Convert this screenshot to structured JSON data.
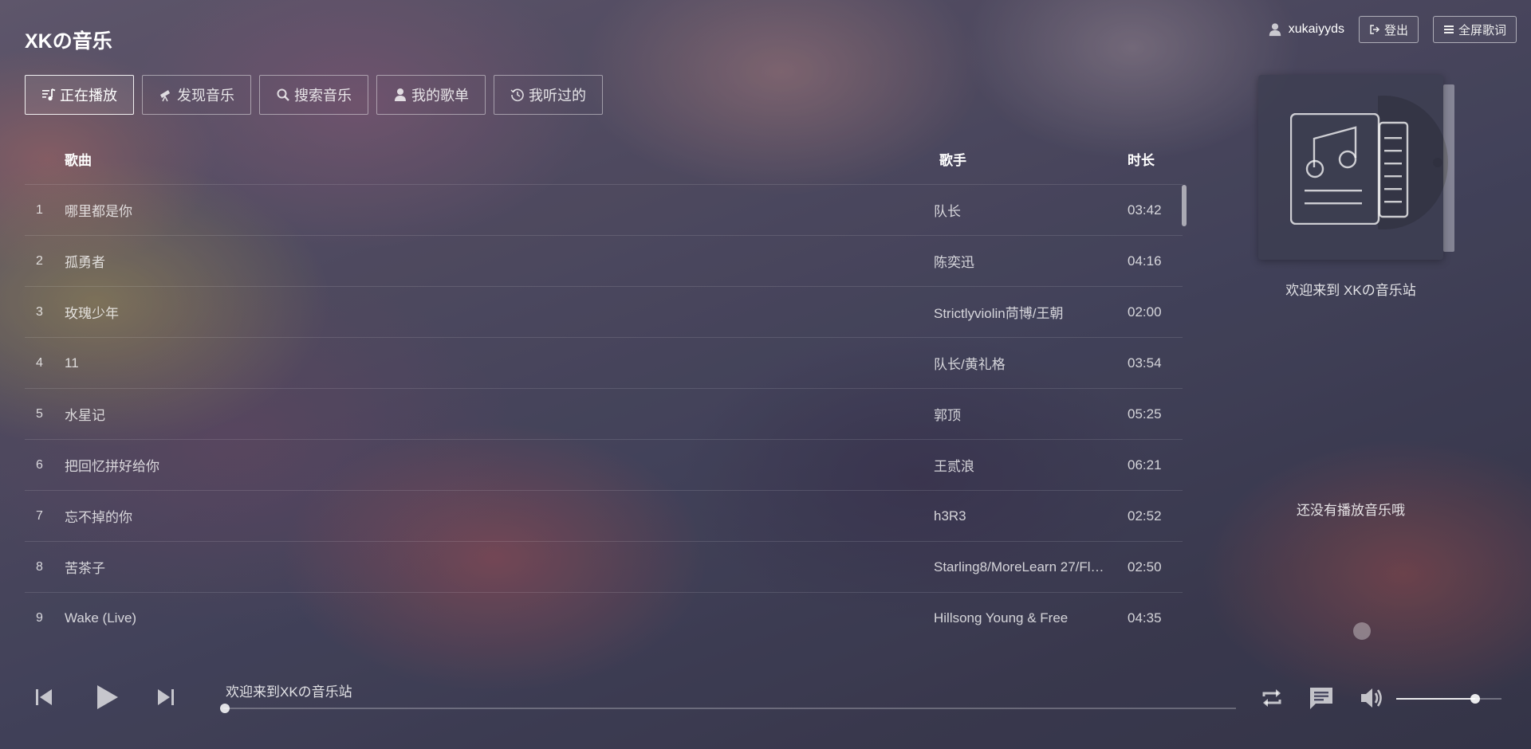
{
  "header": {
    "title": "XKの音乐",
    "username": "xukaiyyds",
    "logout_label": "登出",
    "fullscreen_lyrics_label": "全屏歌词"
  },
  "tabs": [
    {
      "label": "正在播放",
      "icon": "now-playing-icon",
      "active": true
    },
    {
      "label": "发现音乐",
      "icon": "telescope-icon",
      "active": false
    },
    {
      "label": "搜索音乐",
      "icon": "search-icon",
      "active": false
    },
    {
      "label": "我的歌单",
      "icon": "user-icon",
      "active": false
    },
    {
      "label": "我听过的",
      "icon": "history-icon",
      "active": false
    }
  ],
  "table": {
    "headers": {
      "song": "歌曲",
      "artist": "歌手",
      "duration": "时长"
    },
    "rows": [
      {
        "index": "1",
        "song": "哪里都是你",
        "artist": "队长",
        "duration": "03:42"
      },
      {
        "index": "2",
        "song": "孤勇者",
        "artist": "陈奕迅",
        "duration": "04:16"
      },
      {
        "index": "3",
        "song": "玫瑰少年",
        "artist": "Strictlyviolin苘博/王朝",
        "duration": "02:00"
      },
      {
        "index": "4",
        "song": "11",
        "artist": "队长/黄礼格",
        "duration": "03:54"
      },
      {
        "index": "5",
        "song": "水星记",
        "artist": "郭顶",
        "duration": "05:25"
      },
      {
        "index": "6",
        "song": "把回忆拼好给你",
        "artist": "王贰浪",
        "duration": "06:21"
      },
      {
        "index": "7",
        "song": "忘不掉的你",
        "artist": "h3R3",
        "duration": "02:52"
      },
      {
        "index": "8",
        "song": "苦茶子",
        "artist": "Starling8/MoreLearn 27/Fl…",
        "duration": "02:50"
      },
      {
        "index": "9",
        "song": "Wake (Live)",
        "artist": "Hillsong Young & Free",
        "duration": "04:35"
      }
    ]
  },
  "side": {
    "welcome": "欢迎来到 XKの音乐站",
    "no_music": "还没有播放音乐哦"
  },
  "player": {
    "now_playing": "欢迎来到XKの音乐站",
    "progress": 0,
    "volume": 0.75
  }
}
